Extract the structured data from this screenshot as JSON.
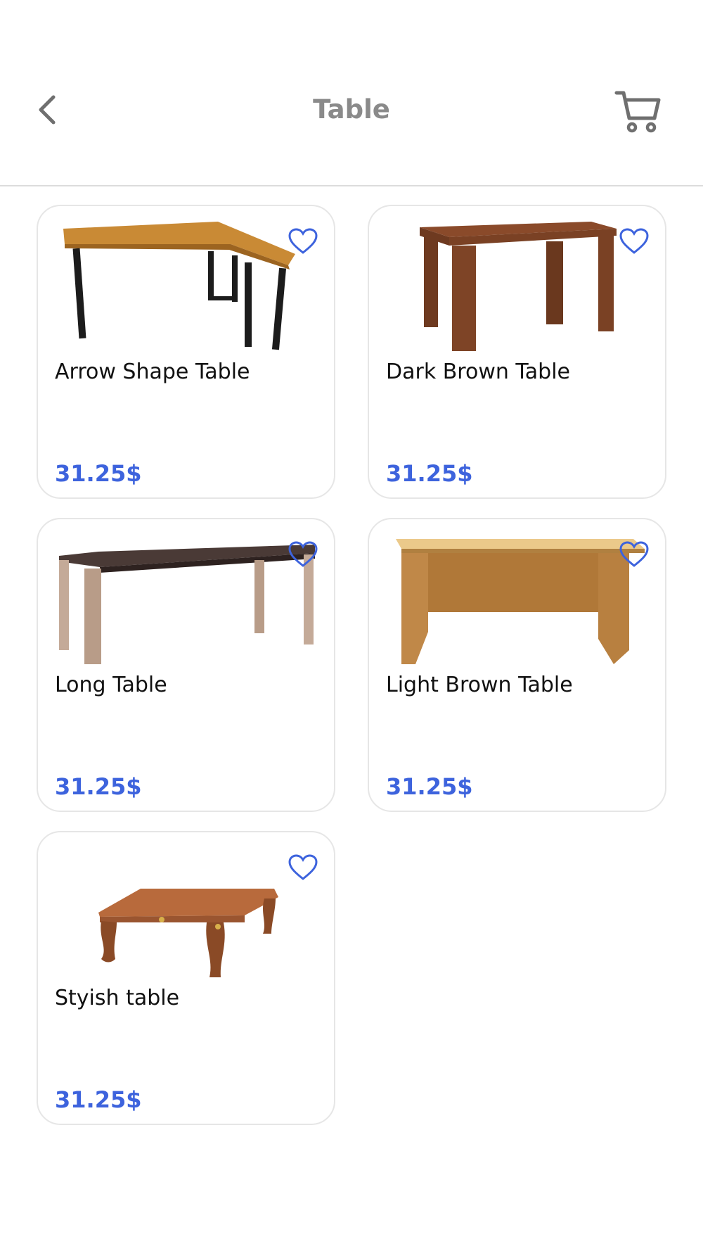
{
  "header": {
    "title": "Table",
    "back_icon": "chevron-left-icon",
    "cart_icon": "cart-icon"
  },
  "colors": {
    "accent": "#3d63dd",
    "title": "#8a8a8a",
    "border": "#e6e6e6"
  },
  "products": [
    {
      "name": "Arrow Shape Table",
      "price": "31.25$",
      "favorite_icon": "heart-outline-icon"
    },
    {
      "name": "Dark Brown Table",
      "price": "31.25$",
      "favorite_icon": "heart-outline-icon"
    },
    {
      "name": "Long Table",
      "price": "31.25$",
      "favorite_icon": "heart-outline-icon"
    },
    {
      "name": "Light Brown Table",
      "price": "31.25$",
      "favorite_icon": "heart-outline-icon"
    },
    {
      "name": "Styish table",
      "price": "31.25$",
      "favorite_icon": "heart-outline-icon"
    }
  ]
}
